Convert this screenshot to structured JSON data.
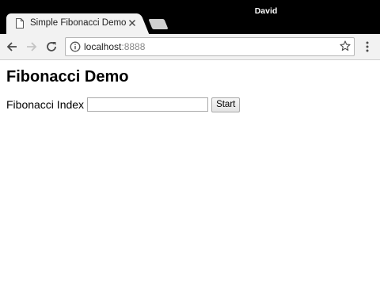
{
  "browser": {
    "tab": {
      "title": "Simple Fibonacci Demo",
      "page_icon": "page-icon",
      "close_icon": "close-icon"
    },
    "profile_name": "David",
    "address_bar": {
      "host": "localhost",
      "port": ":8888"
    },
    "icons": {
      "back": "back-arrow-icon",
      "forward": "forward-arrow-icon",
      "reload": "reload-icon",
      "info": "info-icon",
      "bookmark": "star-icon",
      "menu": "kebab-menu-icon"
    }
  },
  "page": {
    "heading": "Fibonacci Demo",
    "form": {
      "index_label": "Fibonacci Index",
      "index_value": "",
      "start_label": "Start"
    }
  }
}
